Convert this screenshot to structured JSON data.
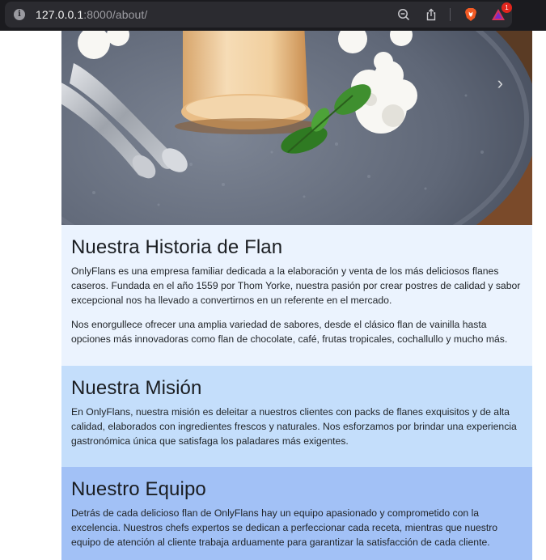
{
  "browser": {
    "url_host": "127.0.0.1",
    "url_rest": ":8000/about/",
    "rewards_badge": "1"
  },
  "hero": {
    "next_arrow": "›"
  },
  "history": {
    "title": "Nuestra Historia de Flan",
    "p1": "OnlyFlans es una empresa familiar dedicada a la elaboración y venta de los más deliciosos flanes caseros. Fundada en el año 1559 por Thom Yorke, nuestra pasión por crear postres de calidad y sabor excepcional nos ha llevado a convertirnos en un referente en el mercado.",
    "p2": "Nos enorgullece ofrecer una amplia variedad de sabores, desde el clásico flan de vainilla hasta opciones más innovadoras como flan de chocolate, café, frutas tropicales, cochallullo y mucho más."
  },
  "mission": {
    "title": "Nuestra Misión",
    "p1": "En OnlyFlans, nuestra misión es deleitar a nuestros clientes con packs de flanes exquisitos y de alta calidad, elaborados con ingredientes frescos y naturales. Nos esforzamos por brindar una experiencia gastronómica única que satisfaga los paladares más exigentes."
  },
  "team": {
    "title": "Nuestro Equipo",
    "p1": "Detrás de cada delicioso flan de OnlyFlans hay un equipo apasionado y comprometido con la excelencia. Nuestros chefs expertos se dedican a perfeccionar cada receta, mientras que nuestro equipo de atención al cliente trabaja arduamente para garantizar la satisfacción de cada cliente."
  },
  "colors": {
    "history_bg": "#ebf3fe",
    "mission_bg": "#c4defb",
    "team_bg": "#a2c1f6"
  }
}
